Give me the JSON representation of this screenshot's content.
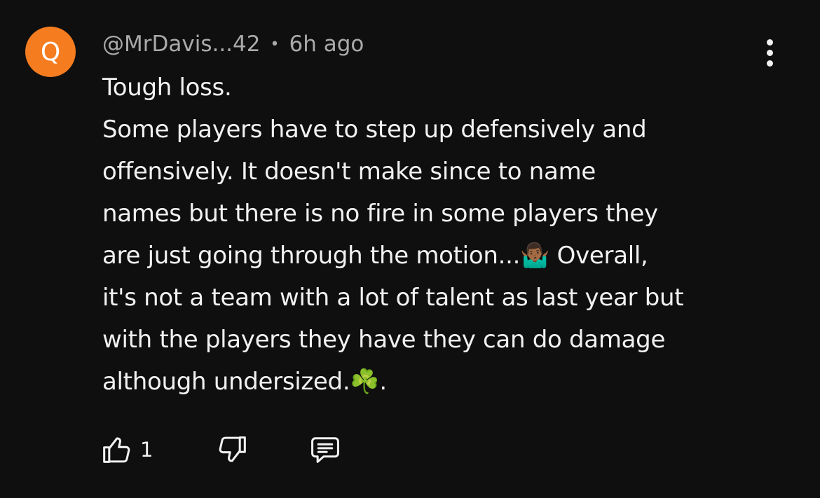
{
  "comment": {
    "avatar_letter": "Q",
    "author": "@MrDavis...42",
    "separator": "•",
    "time": "6h ago",
    "lines": [
      "Tough loss.",
      "Some players have to step up defensively and",
      "offensively. It doesn't make since to name",
      "names but there is no fire in some players they",
      "are just going through the motion...🤷🏾‍♂️ Overall,",
      "it's not a team with a lot of talent as last year but",
      "with the players they have they can do damage",
      "although undersized.☘️."
    ],
    "like_count": "1"
  },
  "icons": {
    "menu": "more-vert-icon",
    "like": "thumbs-up-icon",
    "dislike": "thumbs-down-icon",
    "reply": "reply-comment-icon"
  },
  "colors": {
    "background": "#0f0f0f",
    "avatar": "#f57c1f",
    "text": "#f1f1f1",
    "meta": "#aaaaaa"
  }
}
